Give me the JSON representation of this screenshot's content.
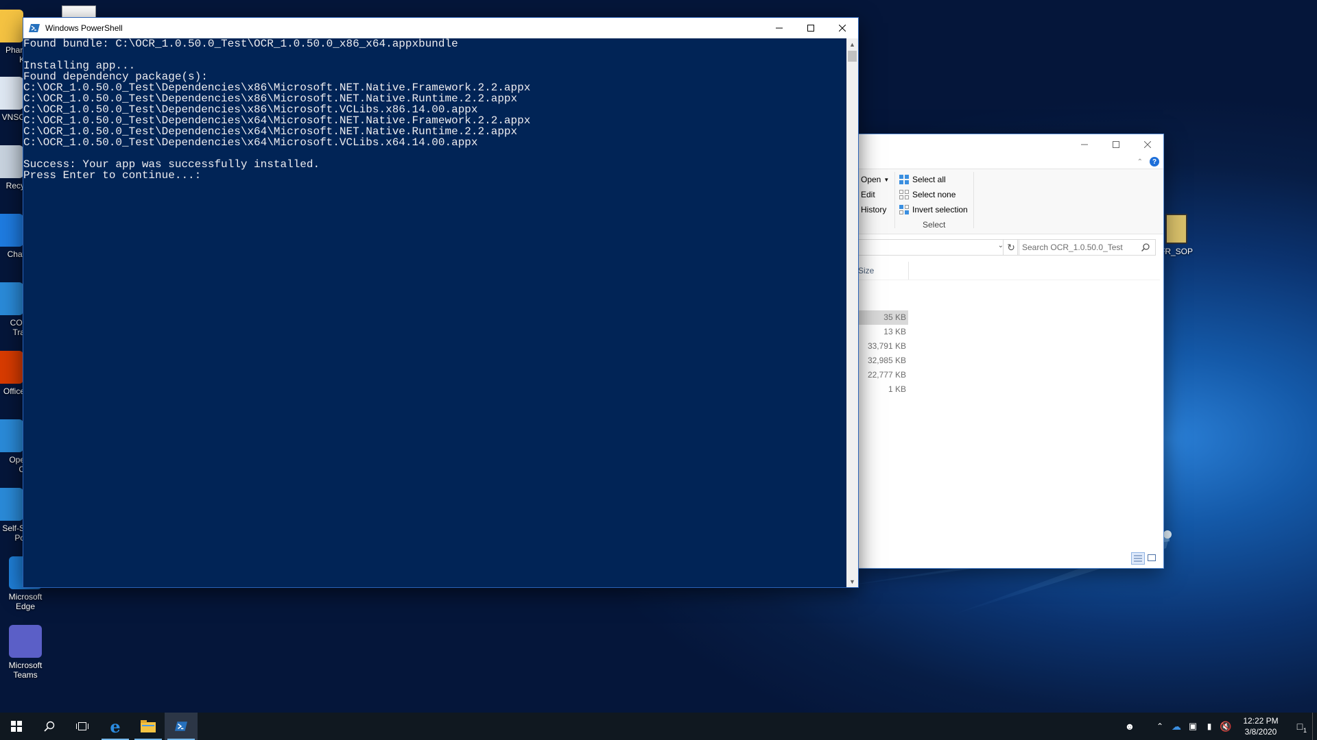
{
  "desktop": {
    "icons": [
      {
        "label": "Phan\nK",
        "icon": "folder-icon"
      },
      {
        "label": "VNSC",
        "icon": "vnc-icon"
      },
      {
        "label": "Recy",
        "icon": "recycle-bin-icon"
      },
      {
        "label": "Chat",
        "icon": "chat-icon"
      },
      {
        "label": "COI\nTra",
        "icon": "app-shortcut-icon"
      },
      {
        "label": "Office",
        "icon": "office-icon"
      },
      {
        "label": "Ope\nC",
        "icon": "app-shortcut-icon"
      },
      {
        "label": "Self-S\nPo",
        "icon": "app-shortcut-icon"
      },
      {
        "label": "Microsoft\nEdge",
        "icon": "edge-icon"
      },
      {
        "label": "Microsoft\nTeams",
        "icon": "teams-icon"
      }
    ],
    "right_icon_label": "FR_SOP"
  },
  "powershell": {
    "title": "Windows PowerShell",
    "console_lines": [
      "Found bundle: C:\\OCR_1.0.50.0_Test\\OCR_1.0.50.0_x86_x64.appxbundle",
      "",
      "Installing app...",
      "Found dependency package(s):",
      "C:\\OCR_1.0.50.0_Test\\Dependencies\\x86\\Microsoft.NET.Native.Framework.2.2.appx",
      "C:\\OCR_1.0.50.0_Test\\Dependencies\\x86\\Microsoft.NET.Native.Runtime.2.2.appx",
      "C:\\OCR_1.0.50.0_Test\\Dependencies\\x86\\Microsoft.VCLibs.x86.14.00.appx",
      "C:\\OCR_1.0.50.0_Test\\Dependencies\\x64\\Microsoft.NET.Native.Framework.2.2.appx",
      "C:\\OCR_1.0.50.0_Test\\Dependencies\\x64\\Microsoft.NET.Native.Runtime.2.2.appx",
      "C:\\OCR_1.0.50.0_Test\\Dependencies\\x64\\Microsoft.VCLibs.x64.14.00.appx",
      "",
      "Success: Your app was successfully installed.",
      "Press Enter to continue...:"
    ],
    "colors": {
      "background": "#012456",
      "text": "#eeedf0"
    }
  },
  "explorer": {
    "ribbon": {
      "open": "Open",
      "edit": "Edit",
      "history": "History",
      "select_all": "Select all",
      "select_none": "Select none",
      "invert_selection": "Invert selection",
      "group_label": "Select"
    },
    "search_placeholder": "Search OCR_1.0.50.0_Test",
    "column_size": "Size",
    "sizes": [
      "35 KB",
      "13 KB",
      "33,791 KB",
      "32,985 KB",
      "22,777 KB",
      "1 KB"
    ]
  },
  "taskbar": {
    "apps": [
      "start-icon",
      "search-icon",
      "task-view-icon",
      "edge-icon",
      "file-explorer-icon",
      "powershell-icon"
    ],
    "active_app": "powershell-icon",
    "clock_time": "12:22 PM",
    "clock_date": "3/8/2020",
    "notification_count": "1"
  }
}
